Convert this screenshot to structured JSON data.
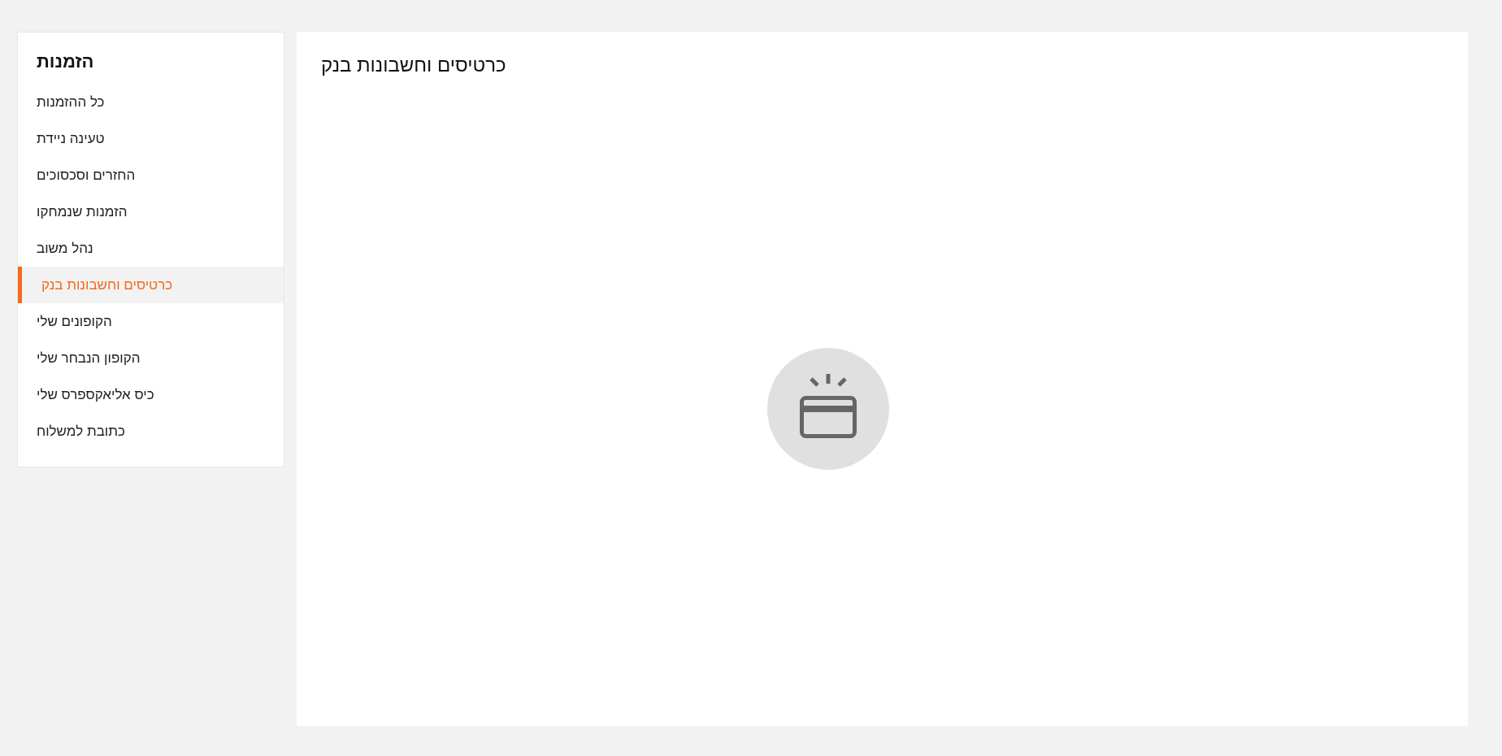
{
  "sidebar": {
    "title": "הזמנות",
    "items": [
      {
        "label": "כל ההזמנות",
        "selected": false
      },
      {
        "label": "טעינה ניידת",
        "selected": false
      },
      {
        "label": "החזרים וסכסוכים",
        "selected": false
      },
      {
        "label": "הזמנות שנמחקו",
        "selected": false
      },
      {
        "label": "נהל משוב",
        "selected": false
      },
      {
        "label": "כרטיסים וחשבונות בנק",
        "selected": true
      },
      {
        "label": "הקופונים שלי",
        "selected": false
      },
      {
        "label": "הקופון הנבחר שלי",
        "selected": false
      },
      {
        "label": "כיס אליאקספרס שלי",
        "selected": false
      },
      {
        "label": "כתובת למשלוח",
        "selected": false
      }
    ]
  },
  "main": {
    "title": "כרטיסים וחשבונות בנק"
  }
}
